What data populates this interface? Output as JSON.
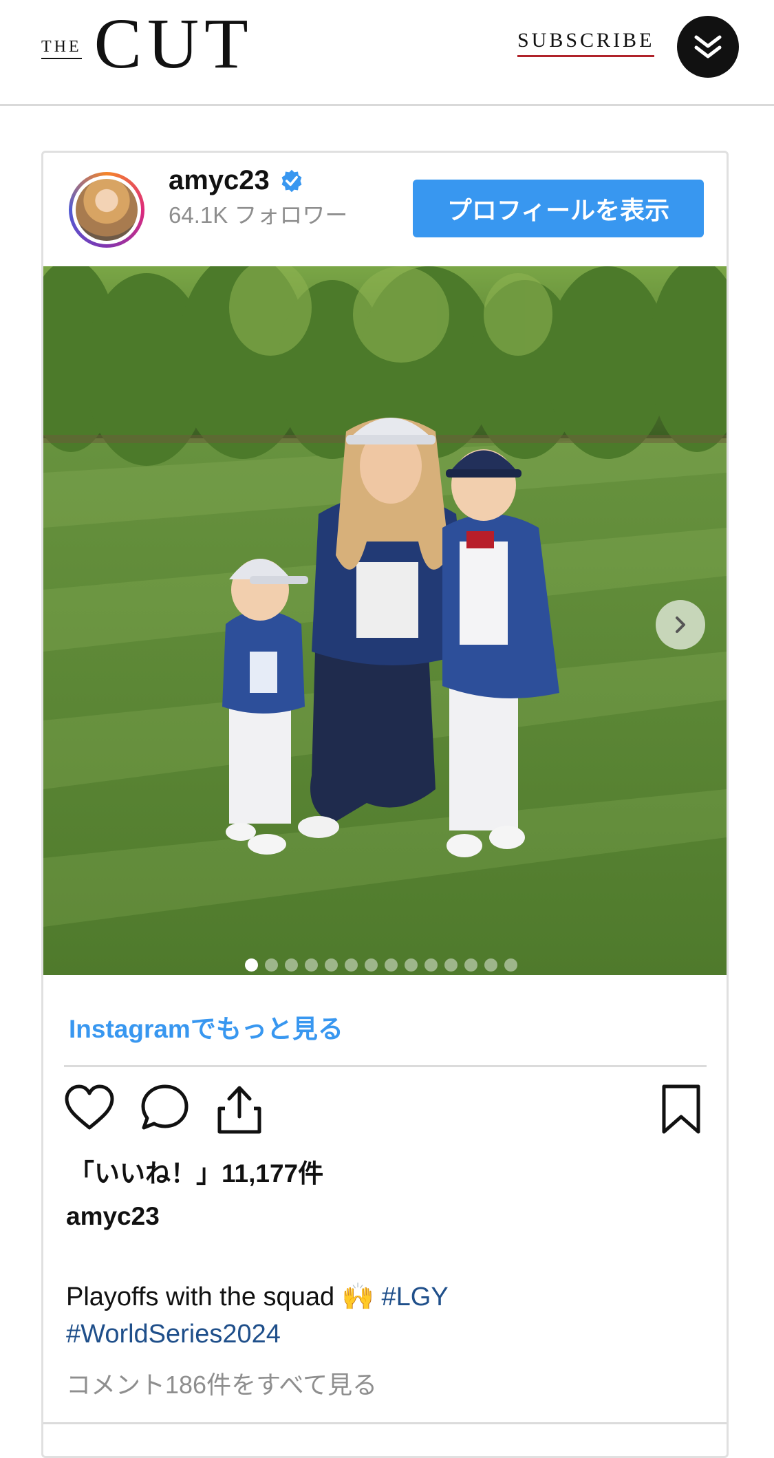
{
  "header": {
    "logo_the": "THE",
    "logo_cut": "CUT",
    "subscribe_label": "SUBSCRIBE",
    "menu_icon": "double-chevron-down-icon"
  },
  "post": {
    "username": "amyc23",
    "verified_icon": "verified-badge-icon",
    "followers": "64.1K フォロワー",
    "view_profile_label": "プロフィールを表示",
    "image_alt": "Woman kneeling on grass with two young boys in pinstripe baseball uniforms and caps",
    "carousel": {
      "total_slides": 14,
      "active_slide": 1
    },
    "more_link": "Instagramでもっと見る",
    "likes": "「いいね！」11,177件",
    "caption_user": "amyc23",
    "caption_text": "Playoffs with the squad 🙌 ",
    "hashtag1": "#LGY",
    "hashtag2": "#WorldSeries2024",
    "comments_link": "コメント186件をすべて見る",
    "icons": {
      "like": "heart-icon",
      "comment": "comment-icon",
      "share": "share-icon",
      "save": "bookmark-icon",
      "next": "chevron-right-icon"
    }
  },
  "colors": {
    "button_blue": "#3897f0",
    "hashtag_blue": "#1f4f8a",
    "subscribe_underline": "#b0232a"
  }
}
